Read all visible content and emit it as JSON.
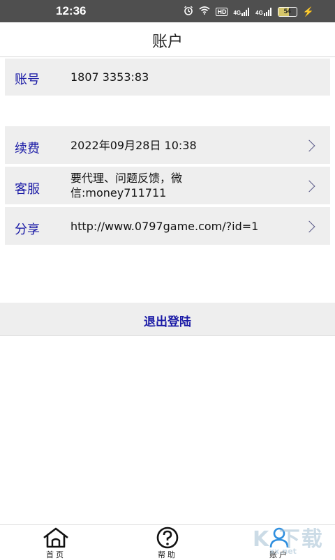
{
  "status_bar": {
    "time": "12:36",
    "icons": [
      "alarm-icon",
      "wifi-icon",
      "hd-icon",
      "signal-4g-icon",
      "signal-4g-icon",
      "battery-icon"
    ],
    "hd_label": "HD",
    "net1_label": "4G",
    "net2_label": "4G",
    "battery_level": "54"
  },
  "header": {
    "title": "账户"
  },
  "account": {
    "label": "账号",
    "value": "1807 3353:83"
  },
  "rows": [
    {
      "label": "续费",
      "value": "2022年09月28日 10:38"
    },
    {
      "label": "客服",
      "value": "要代理、问题反馈，微信:money711711"
    },
    {
      "label": "分享",
      "value": "http://www.0797game.com/?id=1"
    }
  ],
  "logout": {
    "label": "退出登陆"
  },
  "tabbar": {
    "items": [
      {
        "label": "首页",
        "icon": "home-icon"
      },
      {
        "label": "帮助",
        "icon": "help-icon"
      },
      {
        "label": "账户",
        "icon": "user-icon",
        "active": true
      }
    ]
  },
  "watermark": {
    "big": "K 下载",
    "small": "xx.net"
  },
  "colors": {
    "accent": "#1a1aa6",
    "row_bg": "#eeeeee",
    "status_bg": "#4f4f4f",
    "active_tab": "#2f8fdf"
  }
}
